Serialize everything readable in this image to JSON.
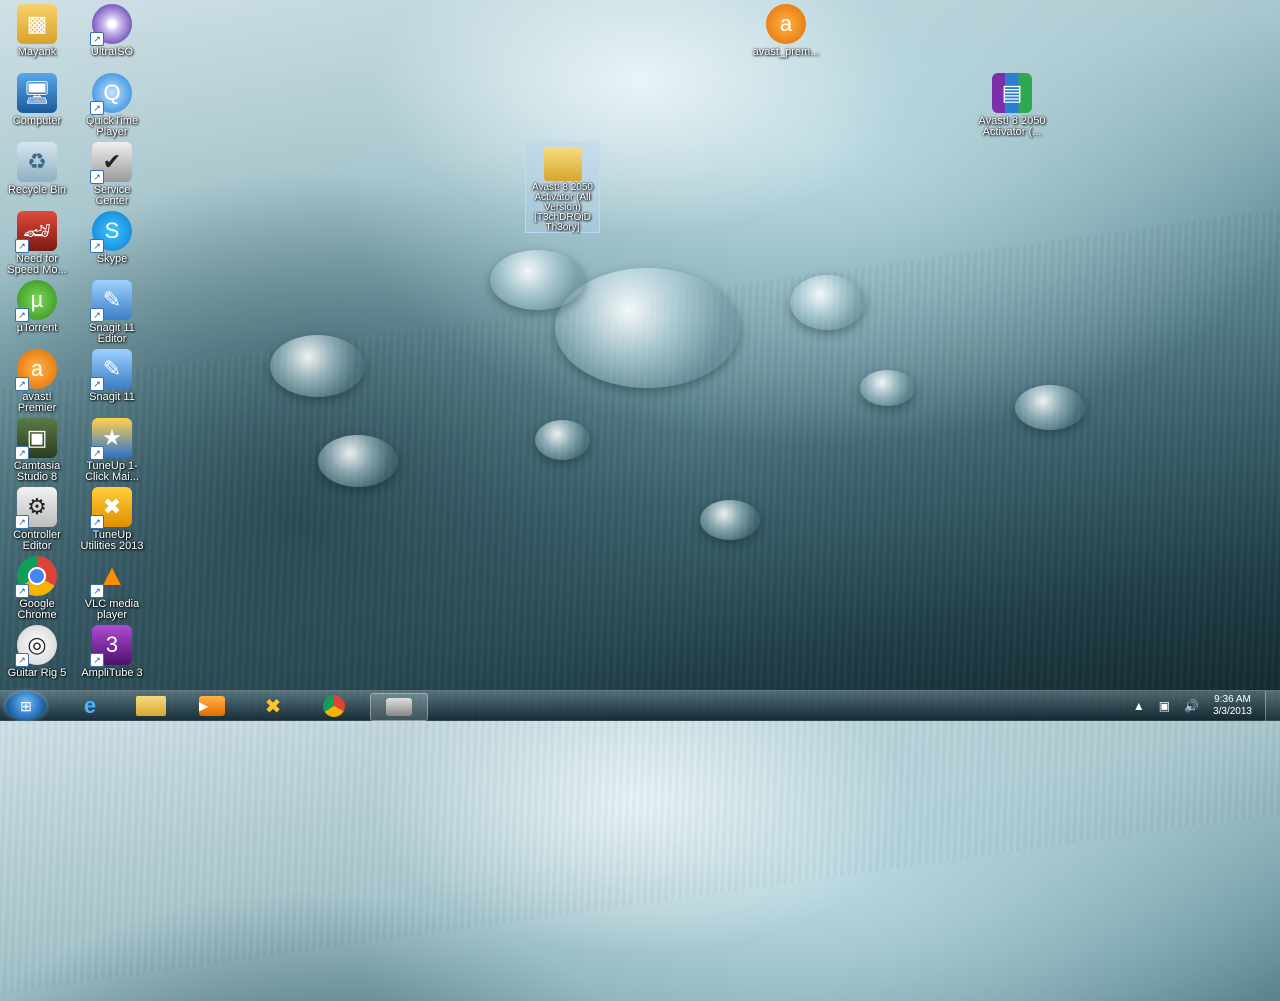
{
  "desktop": {
    "icons": [
      {
        "label": "Mayank"
      },
      {
        "label": "UltraISO"
      },
      {
        "label": "Computer"
      },
      {
        "label": "QuickTime Player"
      },
      {
        "label": "Recycle Bin"
      },
      {
        "label": "Service Center"
      },
      {
        "label": "Need for Speed Mo..."
      },
      {
        "label": "Skype"
      },
      {
        "label": "µTorrent"
      },
      {
        "label": "Snagit 11 Editor"
      },
      {
        "label": "avast! Premier"
      },
      {
        "label": "Snagit 11"
      },
      {
        "label": "Camtasia Studio 8"
      },
      {
        "label": "TuneUp 1-Click Mai..."
      },
      {
        "label": "Controller Editor"
      },
      {
        "label": "TuneUp Utilities 2013"
      },
      {
        "label": "Google Chrome"
      },
      {
        "label": "VLC media player"
      },
      {
        "label": "Guitar Rig 5"
      },
      {
        "label": "AmpliTube 3"
      },
      {
        "label": "avast_prem..."
      },
      {
        "label": "Avast! 8 2050 Activator (..."
      }
    ],
    "selected_item": {
      "label": "Avast! 8 2050 Activator (All Version) [T3chDROiD Th3ory]"
    }
  },
  "taskbar": {
    "clock_time": "9:36 AM",
    "clock_date": "3/3/2013"
  }
}
